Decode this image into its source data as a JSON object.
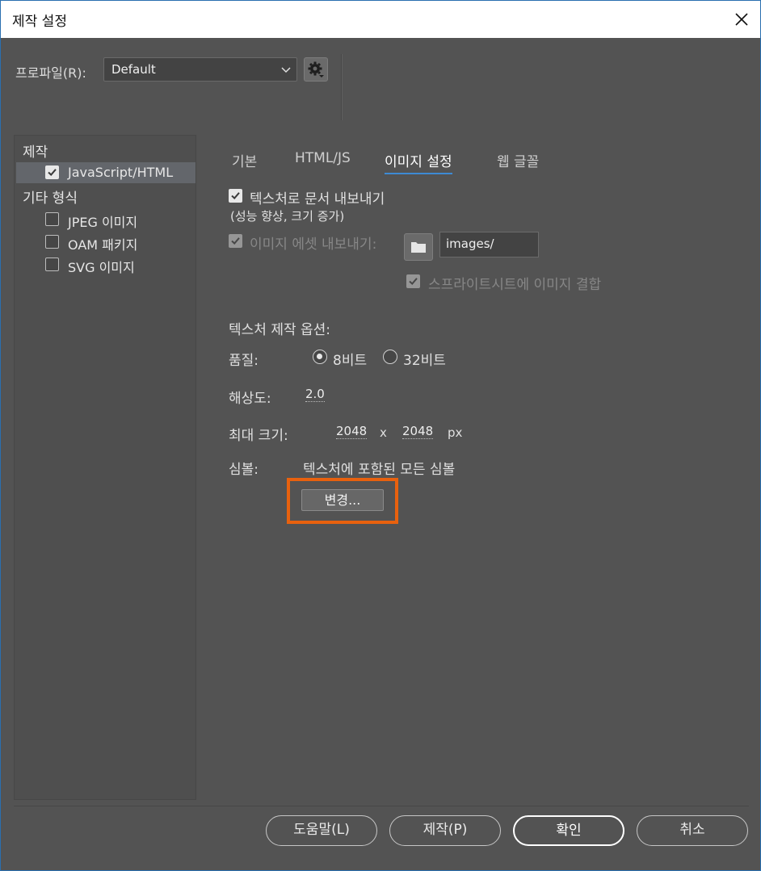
{
  "window": {
    "title": "제작 설정"
  },
  "profile": {
    "label": "프로파일(R):",
    "value": "Default"
  },
  "sidebar": {
    "category1": "제작",
    "item_js": "JavaScript/HTML",
    "category2": "기타 형식",
    "item_jpeg": "JPEG 이미지",
    "item_oam": "OAM 패키지",
    "item_svg": "SVG 이미지"
  },
  "tabs": [
    "기본",
    "HTML/JS",
    "이미지 설정",
    "웹 글꼴"
  ],
  "content": {
    "export_texture": "텍스처로 문서 내보내기",
    "export_texture_note": "(성능 향상, 크기 증가)",
    "export_assets": "이미지 에셋 내보내기:",
    "assets_path": "images/",
    "combine_sprites": "스프라이트시트에 이미지 결합",
    "texture_options": "텍스처 제작 옵션:",
    "quality_label": "품질:",
    "quality_8": "8비트",
    "quality_32": "32비트",
    "resolution_label": "해상도:",
    "resolution_value": "2.0",
    "max_size_label": "최대 크기:",
    "max_w": "2048",
    "x_sep": "x",
    "max_h": "2048",
    "unit": "px",
    "symbols_label": "심볼:",
    "symbols_value": "텍스처에 포함된 모든 심볼",
    "change_button": "변경..."
  },
  "footer": {
    "help": "도움말(L)",
    "publish": "제작(P)",
    "ok": "확인",
    "cancel": "취소"
  },
  "colors": {
    "accent_highlight": "#e8610e",
    "tab_underline": "#3d8ad4"
  }
}
